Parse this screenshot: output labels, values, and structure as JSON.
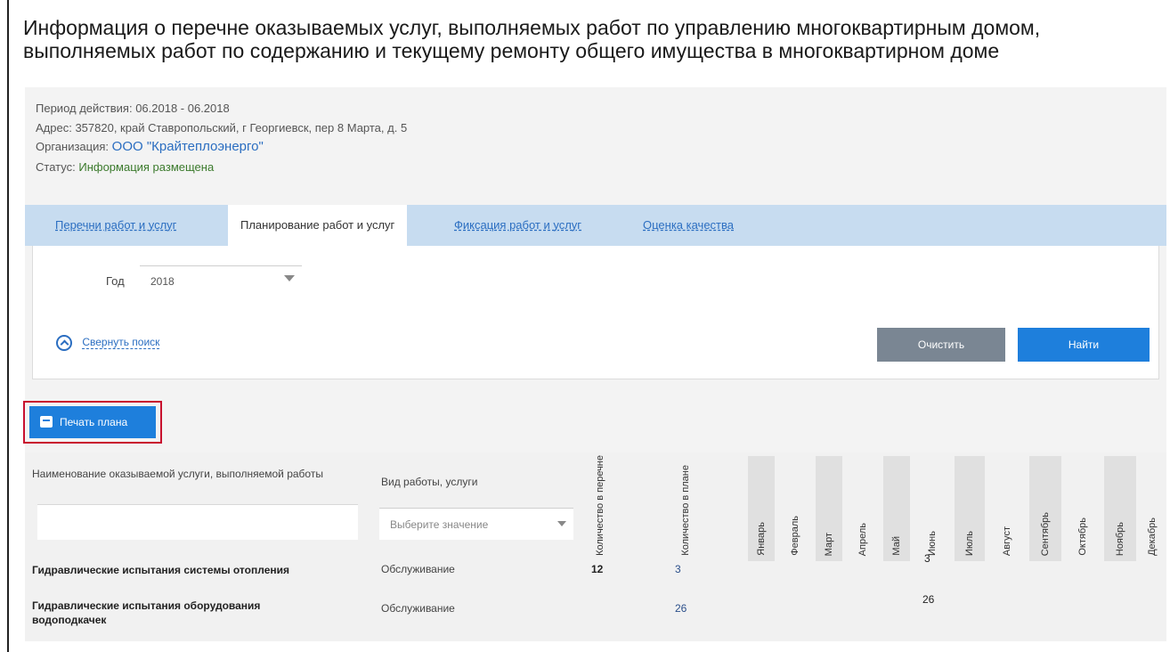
{
  "title": {
    "line1": "Информация о перечне оказываемых услуг, выполняемых работ по управлению многоквартирным домом,",
    "line2": "выполняемых работ по содержанию и текущему ремонту общего имущества в многоквартирном доме"
  },
  "info": {
    "period_label": "Период действия:",
    "period_value": "06.2018 - 06.2018",
    "address_label": "Адрес:",
    "address_value": "357820, край Ставропольский, г Георгиевск, пер 8 Марта, д. 5",
    "org_label": "Организация:",
    "org_value": "ООО \"Крайтеплоэнерго\"",
    "status_label": "Статус:",
    "status_value": "Информация размещена"
  },
  "tabs": [
    {
      "label": "Перечни работ и услуг",
      "active": false
    },
    {
      "label": "Планирование работ и услуг",
      "active": true
    },
    {
      "label": "Фиксация работ и услуг",
      "active": false
    },
    {
      "label": "Оценка качества",
      "active": false
    }
  ],
  "search": {
    "year_label": "Год",
    "year_value": "2018",
    "collapse_label": "Свернуть поиск",
    "clear_label": "Очистить",
    "find_label": "Найти"
  },
  "print_label": "Печать плана",
  "table": {
    "col_name": "Наименование оказываемой услуги, выполняемой работы",
    "col_kind": "Вид работы, услуги",
    "kind_placeholder": "Выберите значение",
    "col_qty_list": "Количество в перечне",
    "col_qty_plan": "Количество в плане",
    "months": [
      "Январь",
      "Февраль",
      "Март",
      "Апрель",
      "Май",
      "Июнь",
      "Июль",
      "Август",
      "Сентябрь",
      "Октябрь",
      "Ноябрь",
      "Декабрь"
    ],
    "rows": [
      {
        "name": "Гидравлические испытания системы отопления",
        "kind": "Обслуживание",
        "qty_list": "12",
        "qty_plan": "3",
        "june": "3"
      },
      {
        "name": "Гидравлические испытания оборудования водоподкачек",
        "kind": "Обслуживание",
        "qty_list": "",
        "qty_plan": "26",
        "june": "26"
      }
    ]
  },
  "colors": {
    "accent": "#1e7fdc",
    "tabbar": "#c7dcf0",
    "highlight": "#c8102e"
  }
}
